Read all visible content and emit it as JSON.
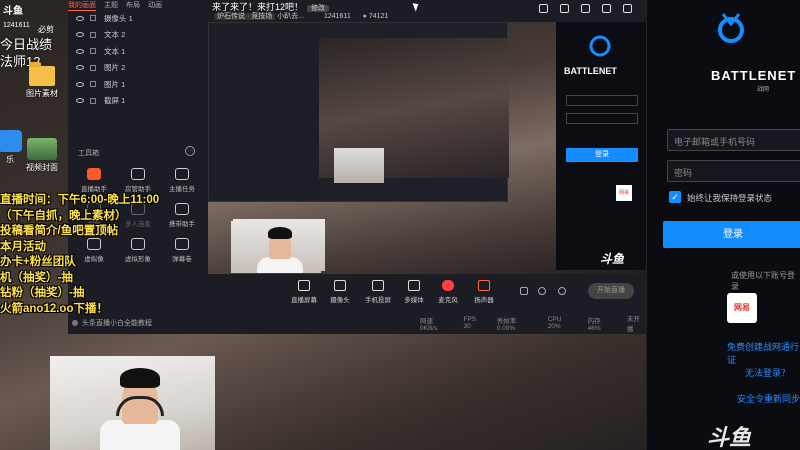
{
  "desktop": {
    "brand": "斗鱼",
    "room_id": "1241611",
    "tag": "必剪",
    "headline_1": "今日战绩",
    "headline_2": "法师12",
    "folder_label": "图片素材",
    "app_label": "乐",
    "video_label": "视频封面"
  },
  "overlay_text": [
    "直播时间：下午6:00-晚上11:00",
    "（下午自抓，晚上素材）",
    "投稿看简介/鱼吧置顶帖",
    "本月活动",
    "办卡+粉丝团队",
    "机（抽奖）-抽",
    "钻粉（抽奖）-抽",
    "火箭ano12.oo下播！"
  ],
  "window": {
    "tabs": [
      "我的画面",
      "主题",
      "布局",
      "动画"
    ],
    "title": "来了来了！来打12吧！",
    "title_btn": "修改",
    "subtitle_chip": "炉石传说 · 竞技场",
    "subtitle_room": "小趴去...",
    "room_id": "1241611",
    "viewers": "74121",
    "layers": [
      {
        "type": "摄像头",
        "label": "摄像头 1"
      },
      {
        "type": "文本",
        "label": "文本 2"
      },
      {
        "type": "文本",
        "label": "文本 1"
      },
      {
        "type": "图片",
        "label": "图片 2"
      },
      {
        "type": "图片",
        "label": "图片 1"
      },
      {
        "type": "截屏",
        "label": "截屏 1"
      }
    ],
    "tools_header": "工具箱",
    "tools": [
      {
        "label": "直播助手",
        "hot": true
      },
      {
        "label": "房管助手"
      },
      {
        "label": "主播任务"
      },
      {
        "label": "视频",
        "dim": true
      },
      {
        "label": "多人连麦",
        "dim": true
      },
      {
        "label": "携带助手"
      },
      {
        "label": "虚拟像"
      },
      {
        "label": "虚拟形象"
      },
      {
        "label": "弹幕卷"
      }
    ],
    "hint": "头条直播小白全能教程",
    "bottom_buttons": [
      "直播屏幕",
      "摄像头",
      "手机投屏",
      "多媒体",
      "麦克风",
      "扬声器"
    ],
    "start_button": "开始直播",
    "status": [
      "网速 0KB/s",
      "FPS 30",
      "丢帧率 0.00%",
      "CPU 20%",
      "内存 46%",
      "未开播"
    ]
  },
  "battlenet": {
    "wordmark": "BATTLENET",
    "sub": "战网",
    "email_placeholder": "电子邮箱或手机号码",
    "password_placeholder": "密码",
    "remember": "始终让我保持登录状态",
    "login_button": "登录",
    "or_text": "或使用以下账号登录",
    "netease": "网易",
    "link_create": "免费创建战网通行证",
    "link_help": "无法登录？",
    "link_security": "安全令重新同步"
  },
  "watermark": "斗鱼"
}
